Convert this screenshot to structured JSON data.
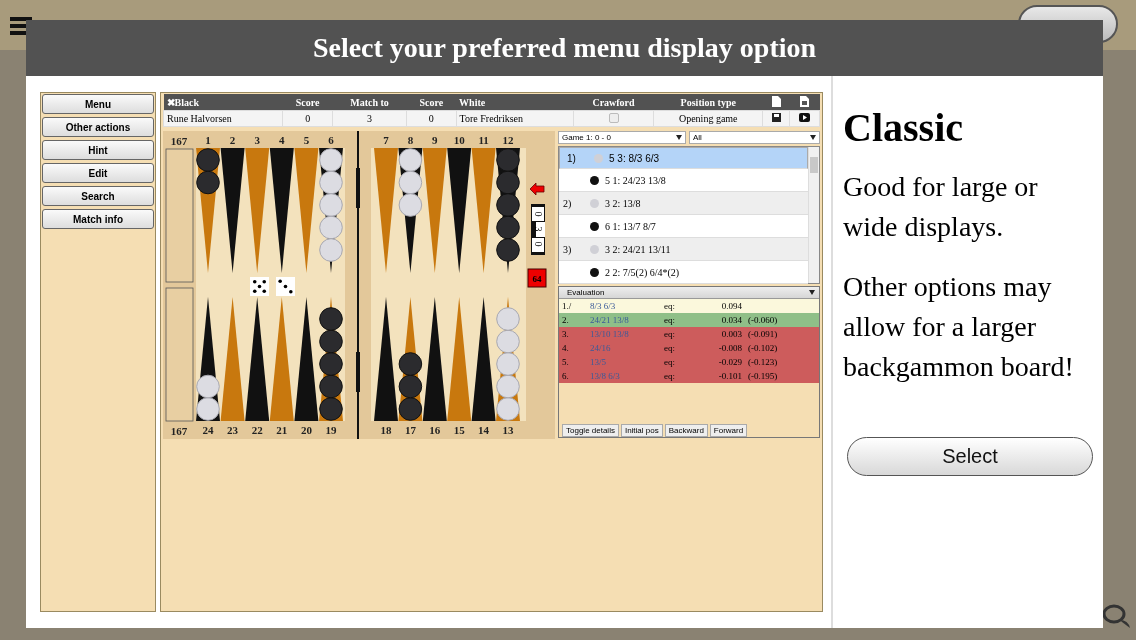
{
  "dialog": {
    "title": "Select your preferred menu display option"
  },
  "preview": {
    "menu_buttons": [
      "Menu",
      "Other actions",
      "Hint",
      "Edit",
      "Search",
      "Match info"
    ],
    "match_table": {
      "columns": [
        "✖Black",
        "Score",
        "Match to",
        "Score",
        "White",
        "Crawford",
        "Position type"
      ],
      "row": {
        "black": "Rune Halvorsen",
        "black_score": "0",
        "match_to": "3",
        "white_score": "0",
        "white": "Tore Fredriksen",
        "crawford": false,
        "position_type": "Opening game"
      }
    },
    "board": {
      "pip_counts": [
        "167",
        "167"
      ],
      "points": [
        {
          "number": "1",
          "checkers": [
            {
              "kind": "black"
            },
            {
              "kind": "black"
            }
          ]
        },
        {
          "number": "2"
        },
        {
          "number": "3"
        },
        {
          "number": "4"
        },
        {
          "number": "5"
        },
        {
          "number": "6",
          "checkers": [
            {
              "kind": "white"
            },
            {
              "kind": "white"
            },
            {
              "kind": "white"
            },
            {
              "kind": "white"
            },
            {
              "kind": "white"
            }
          ]
        },
        {
          "number": "7"
        },
        {
          "number": "8",
          "checkers": [
            {
              "kind": "white"
            },
            {
              "kind": "white"
            },
            {
              "kind": "white"
            }
          ]
        },
        {
          "number": "9"
        },
        {
          "number": "10"
        },
        {
          "number": "11"
        },
        {
          "number": "12",
          "checkers": [
            {
              "kind": "black"
            },
            {
              "kind": "black"
            },
            {
              "kind": "black"
            },
            {
              "kind": "black"
            },
            {
              "kind": "black"
            }
          ]
        },
        {
          "number": "24",
          "checkers": [
            {
              "kind": "white"
            },
            {
              "kind": "white"
            }
          ]
        },
        {
          "number": "23"
        },
        {
          "number": "22"
        },
        {
          "number": "21"
        },
        {
          "number": "20"
        },
        {
          "number": "19",
          "checkers": [
            {
              "kind": "black"
            },
            {
              "kind": "black"
            },
            {
              "kind": "black"
            },
            {
              "kind": "black"
            },
            {
              "kind": "black"
            }
          ]
        },
        {
          "number": "18"
        },
        {
          "number": "17",
          "checkers": [
            {
              "kind": "black"
            },
            {
              "kind": "black"
            },
            {
              "kind": "black"
            }
          ]
        },
        {
          "number": "16"
        },
        {
          "number": "15"
        },
        {
          "number": "14"
        },
        {
          "number": "13",
          "checkers": [
            {
              "kind": "white"
            },
            {
              "kind": "white"
            },
            {
              "kind": "white"
            },
            {
              "kind": "white"
            },
            {
              "kind": "white"
            }
          ]
        }
      ],
      "dice": [
        {
          "kind": "five"
        },
        {
          "kind": "three"
        }
      ],
      "score_marker": [
        "0",
        "3",
        "0"
      ],
      "cube": "64"
    },
    "game_select": "Game 1: 0 - 0",
    "filter_select": "All",
    "moves": [
      {
        "number": "1)",
        "kind": "white",
        "move": "5 3: 8/3 6/3",
        "selected": true
      },
      {
        "kind": "black",
        "move": "5 1: 24/23 13/8",
        "selected": false
      },
      {
        "number": "2)",
        "kind": "white",
        "move": "3 2: 13/8",
        "selected": false
      },
      {
        "kind": "black",
        "move": "6 1: 13/7 8/7",
        "selected": false
      },
      {
        "number": "3)",
        "kind": "white",
        "move": "3 2: 24/21 13/11",
        "selected": false
      },
      {
        "kind": "black",
        "move": "2 2: 7/5(2) 6/4*(2)",
        "selected": false
      }
    ],
    "evaluation": {
      "title": "Evaluation",
      "rows": [
        {
          "rank": "1./",
          "move": "8/3 6/3",
          "label": "eq:",
          "value": "0.094",
          "color": "#fbf8dc"
        },
        {
          "rank": "2.",
          "move": "24/21 13/8",
          "label": "eq:",
          "value": "0.034",
          "diff": "(-0.060)",
          "color": "#8fbf88"
        },
        {
          "rank": "3.",
          "move": "13/10 13/8",
          "label": "eq:",
          "value": "0.003",
          "diff": "(-0.091)",
          "color": "#cd5c5c"
        },
        {
          "rank": "4.",
          "move": "24/16",
          "label": "eq:",
          "value": "-0.008",
          "diff": "(-0.102)",
          "color": "#cd5c5c"
        },
        {
          "rank": "5.",
          "move": "13/5",
          "label": "eq:",
          "value": "-0.029",
          "diff": "(-0.123)",
          "color": "#cd5c5c"
        },
        {
          "rank": "6.",
          "move": "13/8 6/3",
          "label": "eq:",
          "value": "-0.101",
          "diff": "(-0.195)",
          "color": "#cd5c5c"
        }
      ]
    },
    "buttons": [
      "Toggle details",
      "Initial pos",
      "Backward",
      "Forward"
    ]
  },
  "option": {
    "title": "Classic",
    "description": "Good for large or wide displays.",
    "note": "Other options may allow for a larger backgammon board!",
    "button": "Select"
  }
}
